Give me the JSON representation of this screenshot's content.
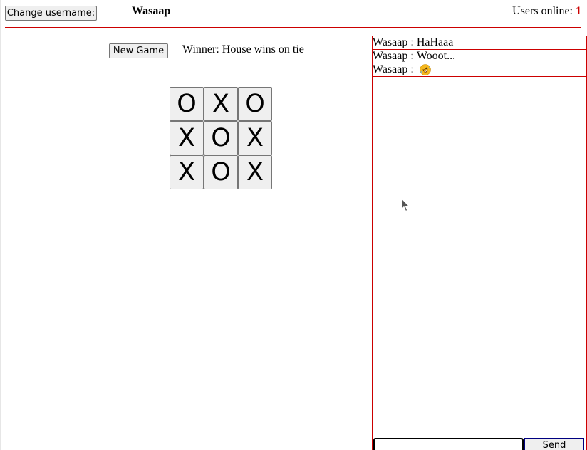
{
  "header": {
    "change_username_label": "Change username:",
    "title": "Wasaap",
    "users_online_label": "Users online: ",
    "users_online_count": "1"
  },
  "game": {
    "new_game_label": "New Game",
    "winner_text": "Winner: House wins on tie",
    "board": [
      [
        "O",
        "X",
        "O"
      ],
      [
        "X",
        "O",
        "X"
      ],
      [
        "X",
        "O",
        "X"
      ]
    ]
  },
  "chat": {
    "messages": [
      {
        "user": "Wasaap",
        "separator": " : ",
        "text": "HaHaaa"
      },
      {
        "user": "Wasaap",
        "separator": " : ",
        "text": "Wooot..."
      },
      {
        "user": "Wasaap",
        "separator": " : ",
        "text": "",
        "icon": "rolling-on-floor-laughing-emoji-icon"
      }
    ],
    "input_value": "",
    "send_label": "Send"
  },
  "colors": {
    "accent_red": "#cc0000",
    "button_bg": "#efefef",
    "button_border": "#767676",
    "emoji_yellow": "#f5b81d"
  }
}
